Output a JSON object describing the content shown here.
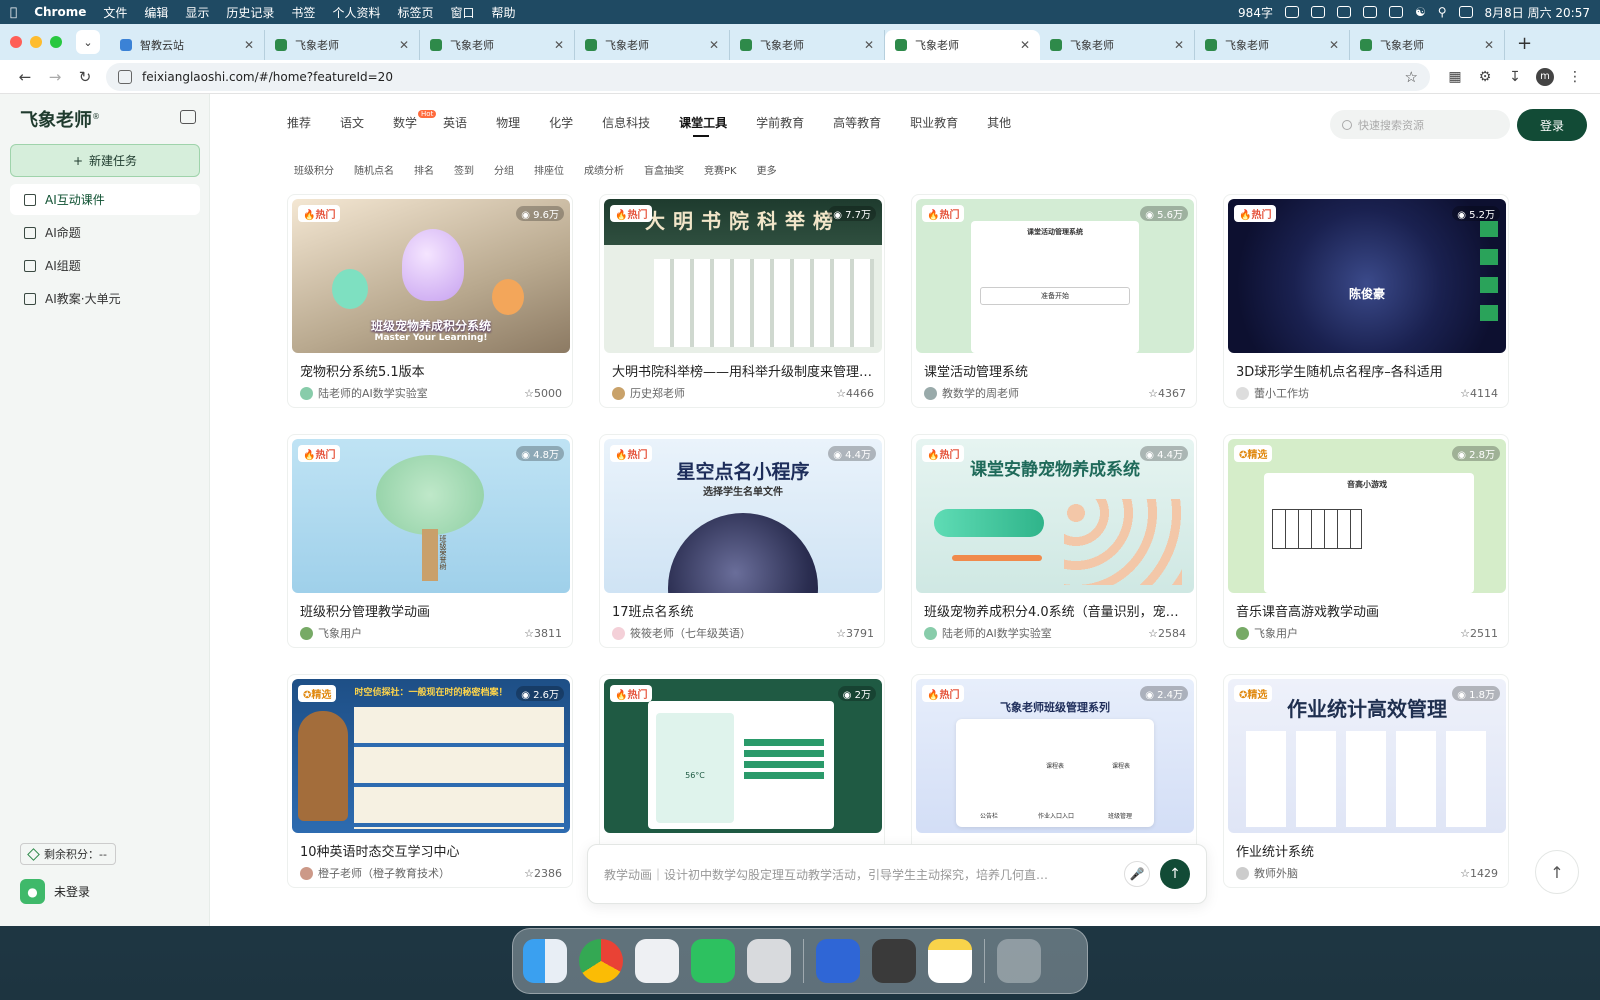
{
  "menubar": {
    "app": "Chrome",
    "items": [
      "文件",
      "编辑",
      "显示",
      "历史记录",
      "书签",
      "个人资料",
      "标签页",
      "窗口",
      "帮助"
    ],
    "word_count": "984字",
    "datetime": "8月8日 周六 20:57"
  },
  "browser": {
    "tabs": [
      {
        "title": "智教云站",
        "favicon": "blue"
      },
      {
        "title": "飞象老师",
        "favicon": "green"
      },
      {
        "title": "飞象老师",
        "favicon": "green"
      },
      {
        "title": "飞象老师",
        "favicon": "green"
      },
      {
        "title": "飞象老师",
        "favicon": "green"
      },
      {
        "title": "飞象老师",
        "favicon": "green",
        "active": true
      },
      {
        "title": "飞象老师",
        "favicon": "green"
      },
      {
        "title": "飞象老师",
        "favicon": "green"
      },
      {
        "title": "飞象老师",
        "favicon": "green"
      }
    ],
    "url": "feixianglaoshi.com/#/home?featureId=20",
    "profile_initial": "m"
  },
  "sidebar": {
    "logo": "飞象老师",
    "logo_mark": "®",
    "new_task": "新建任务",
    "items": [
      {
        "label": "AI互动课件",
        "active": true
      },
      {
        "label": "AI命题"
      },
      {
        "label": "AI组题"
      },
      {
        "label": "AI教案·大单元"
      }
    ],
    "points": "剩余积分：--",
    "login": "未登录"
  },
  "header": {
    "categories": [
      "推荐",
      "语文",
      "数学",
      "英语",
      "物理",
      "化学",
      "信息科技",
      "课堂工具",
      "学前教育",
      "高等教育",
      "职业教育",
      "其他"
    ],
    "active_category": "课堂工具",
    "hot_label": "Hot",
    "search_placeholder": "快速搜索资源",
    "login_button": "登录"
  },
  "subcategories": [
    "班级积分",
    "随机点名",
    "排名",
    "签到",
    "分组",
    "排座位",
    "成绩分析",
    "盲盒抽奖",
    "竞赛PK",
    "更多"
  ],
  "cards": [
    {
      "badge": "热门",
      "views": "9.6万",
      "title": "宠物积分系统5.1版本",
      "author": "陆老师的AI数学实验室",
      "likes": "5000",
      "thumb_text": "班级宠物养成积分系统",
      "thumb_sub": "Master Your Learning!"
    },
    {
      "badge": "热门",
      "views": "7.7万",
      "title": "大明书院科举榜——用科举升级制度来管理…",
      "author": "历史郑老师",
      "likes": "4466",
      "thumb_text": "大明书院科举榜"
    },
    {
      "badge": "热门",
      "views": "5.6万",
      "title": "课堂活动管理系统",
      "author": "教数学的周老师",
      "likes": "4367",
      "thumb_text": "课堂活动管理系统",
      "thumb_sub": "准备开始"
    },
    {
      "badge": "热门",
      "views": "5.2万",
      "title": "3D球形学生随机点名程序–各科适用",
      "author": "蕾小工作坊",
      "likes": "4114",
      "thumb_text": "陈俊豪"
    },
    {
      "badge": "热门",
      "views": "4.8万",
      "title": "班级积分管理教学动画",
      "author": "飞象用户",
      "likes": "3811",
      "thumb_text": "班级荣誉树"
    },
    {
      "badge": "热门",
      "views": "4.4万",
      "title": "17班点名系统",
      "author": "筱筱老师（七年级英语）",
      "likes": "3791",
      "thumb_text": "星空点名小程序",
      "thumb_sub": "选择学生名单文件"
    },
    {
      "badge": "热门",
      "views": "4.4万",
      "title": "班级宠物养成积分4.0系统（音量识别，宠…",
      "author": "陆老师的AI数学实验室",
      "likes": "2584",
      "thumb_text": "课堂安静宠物养成系统"
    },
    {
      "badge": "精选",
      "views": "2.8万",
      "title": "音乐课音高游戏教学动画",
      "author": "飞象用户",
      "likes": "2511",
      "thumb_text": "音高小游戏"
    },
    {
      "badge": "精选",
      "views": "2.6万",
      "title": "10种英语时态交互学习中心",
      "author": "橙子老师（橙子教育技术）",
      "likes": "2386",
      "thumb_text": "时空侦探社：一般现在时的秘密档案！"
    },
    {
      "badge": "热门",
      "views": "2万",
      "title": "",
      "author": "",
      "likes": "",
      "thumb_text": "56°C"
    },
    {
      "badge": "热门",
      "views": "2.4万",
      "title": "",
      "author": "",
      "likes": "",
      "thumb_text": "飞象老师班级管理系列",
      "thumb_items": [
        "课程表",
        "课程表",
        "公告栏",
        "作业入口入口",
        "班级管理"
      ]
    },
    {
      "badge": "精选",
      "views": "1.8万",
      "title": "作业统计系统",
      "author": "教师外脑",
      "likes": "1429",
      "thumb_text": "作业统计高效管理"
    }
  ],
  "prompt": {
    "placeholder": "教学动画｜设计初中数学勾股定理互动教学活动，引导学生主动探究，培养几何直…"
  },
  "colors": {
    "brand": "#124b36",
    "accent_green": "#2e8a4a",
    "hot": "#e5533c"
  }
}
